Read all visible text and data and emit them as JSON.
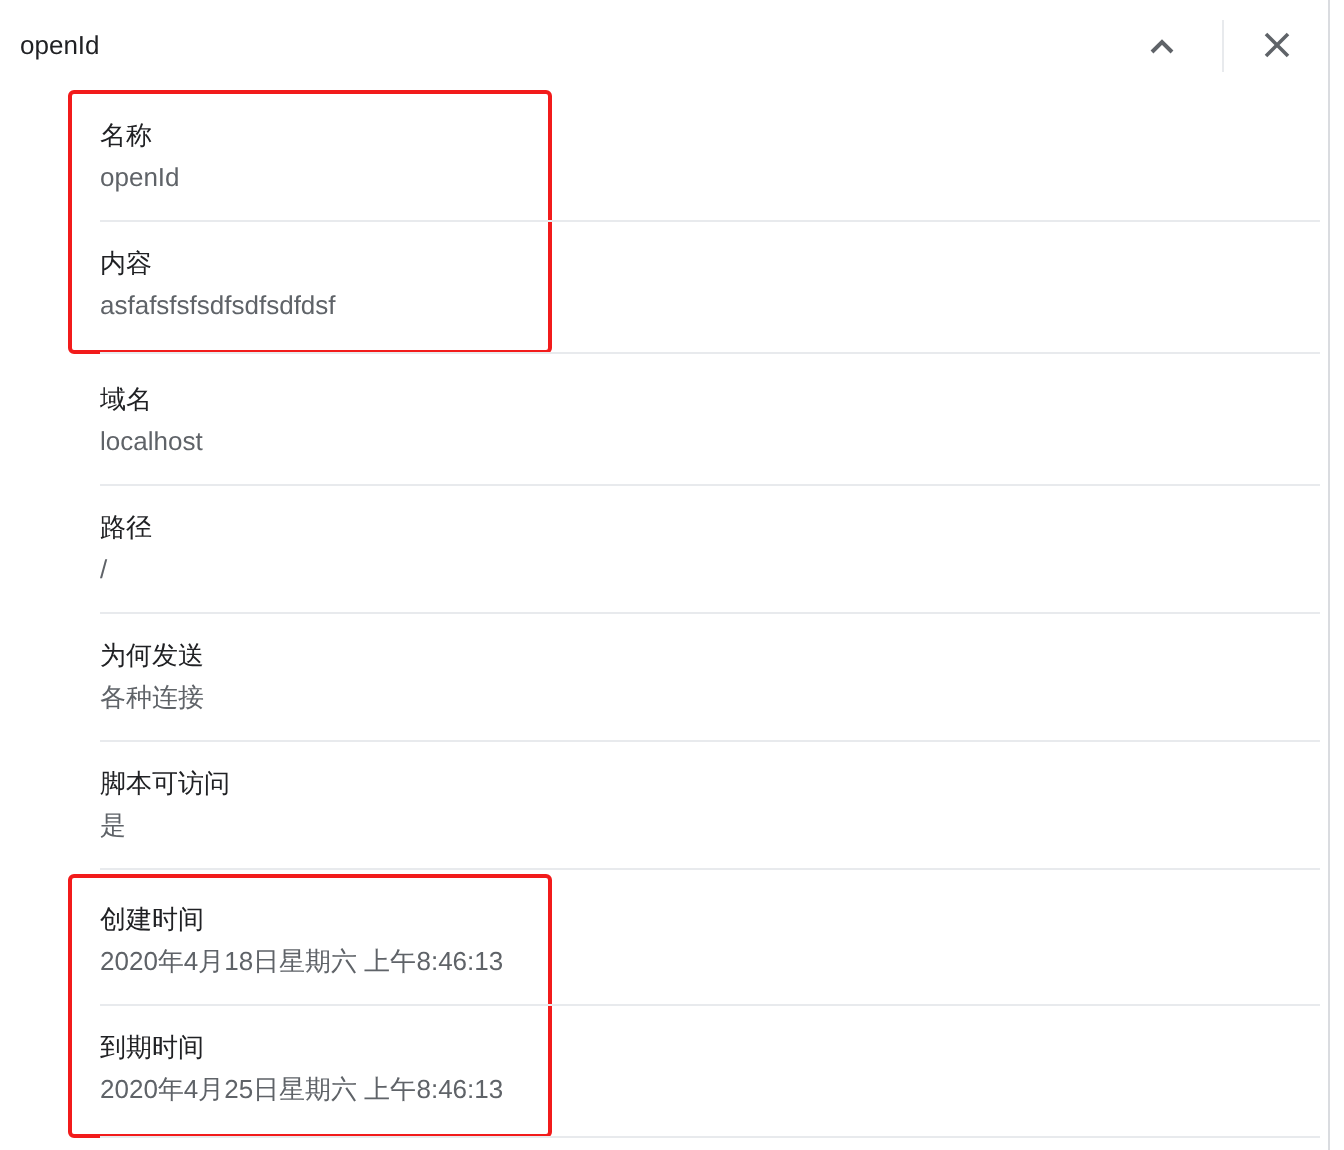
{
  "header": {
    "title": "openId"
  },
  "groups": [
    {
      "highlighted": true,
      "fields": [
        {
          "label": "名称",
          "value": "openId"
        },
        {
          "label": "内容",
          "value": "asfafsfsfsdfsdfsdfdsf"
        }
      ]
    },
    {
      "highlighted": false,
      "fields": [
        {
          "label": "域名",
          "value": "localhost"
        },
        {
          "label": "路径",
          "value": "/"
        },
        {
          "label": "为何发送",
          "value": "各种连接"
        },
        {
          "label": "脚本可访问",
          "value": "是"
        }
      ]
    },
    {
      "highlighted": true,
      "fields": [
        {
          "label": "创建时间",
          "value": "2020年4月18日星期六 上午8:46:13"
        },
        {
          "label": "到期时间",
          "value": "2020年4月25日星期六 上午8:46:13"
        }
      ]
    }
  ]
}
